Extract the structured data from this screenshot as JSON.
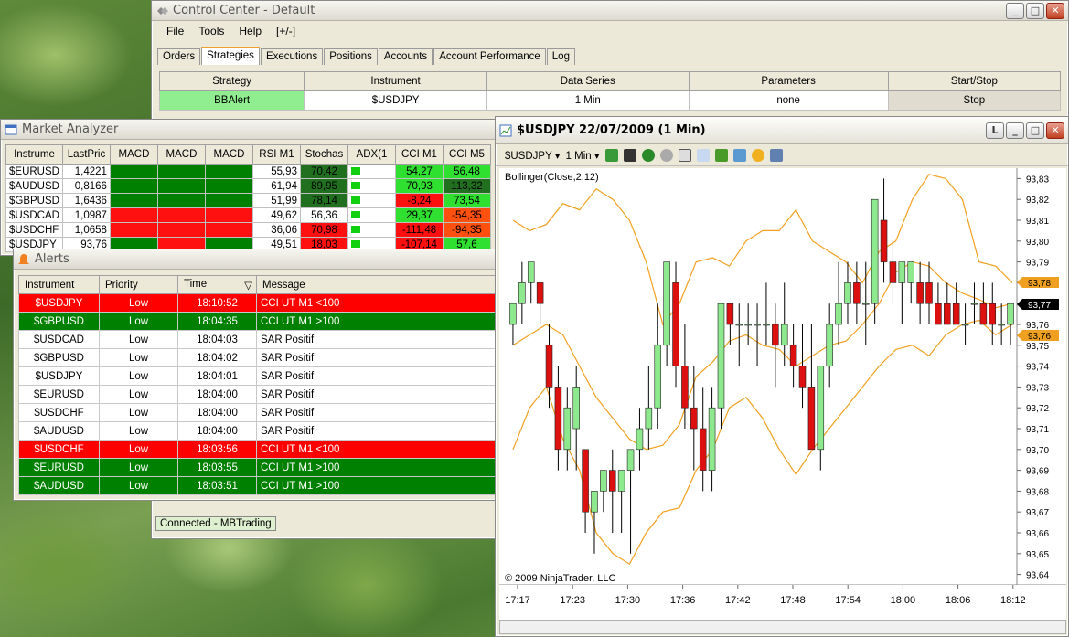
{
  "control_center": {
    "title": "Control Center - Default",
    "menu": [
      "File",
      "Tools",
      "Help",
      "[+/-]"
    ],
    "tabs": [
      "Orders",
      "Strategies",
      "Executions",
      "Positions",
      "Accounts",
      "Account Performance",
      "Log"
    ],
    "selected_tab": "Strategies",
    "strategy_table": {
      "headers": [
        "Strategy",
        "Instrument",
        "Data Series",
        "Parameters",
        "Start/Stop"
      ],
      "rows": [
        {
          "strategy": "BBAlert",
          "instrument": "$USDJPY",
          "series": "1 Min",
          "params": "none",
          "action": "Stop"
        }
      ]
    },
    "status": "Connected - MBTrading"
  },
  "market_analyzer": {
    "title": "Market Analyzer",
    "headers": [
      "Instrume",
      "LastPric",
      "MACD",
      "MACD",
      "MACD",
      "RSI M1",
      "Stochas",
      "ADX(1",
      "CCI M1",
      "CCI M5"
    ],
    "rows": [
      {
        "inst": "$EURUSD",
        "last": "1,4221",
        "macd": [
          "g",
          "g",
          "g"
        ],
        "rsi": "55,93",
        "stoch": "70,42",
        "stoch_c": "dg",
        "adx": "g",
        "cci1": "54,27",
        "cci1_c": "lg",
        "cci5": "56,48",
        "cci5_c": "lg"
      },
      {
        "inst": "$AUDUSD",
        "last": "0,8166",
        "macd": [
          "g",
          "g",
          "g"
        ],
        "rsi": "61,94",
        "stoch": "89,95",
        "stoch_c": "dg",
        "adx": "g",
        "cci1": "70,93",
        "cci1_c": "lg",
        "cci5": "113,32",
        "cci5_c": "dg"
      },
      {
        "inst": "$GBPUSD",
        "last": "1,6436",
        "macd": [
          "g",
          "g",
          "g"
        ],
        "rsi": "51,99",
        "stoch": "78,14",
        "stoch_c": "dg",
        "adx": "g",
        "cci1": "-8,24",
        "cci1_c": "r",
        "cci5": "73,54",
        "cci5_c": "lg"
      },
      {
        "inst": "$USDCAD",
        "last": "1,0987",
        "macd": [
          "r",
          "r",
          "r"
        ],
        "rsi": "49,62",
        "stoch": "56,36",
        "stoch_c": "w",
        "adx": "g",
        "cci1": "29,37",
        "cci1_c": "lg",
        "cci5": "-54,35",
        "cci5_c": "o"
      },
      {
        "inst": "$USDCHF",
        "last": "1,0658",
        "macd": [
          "r",
          "r",
          "r"
        ],
        "rsi": "36,06",
        "stoch": "70,98",
        "stoch_c": "r",
        "adx": "g",
        "cci1": "-111,48",
        "cci1_c": "r",
        "cci5": "-94,35",
        "cci5_c": "o"
      },
      {
        "inst": "$USDJPY",
        "last": "93,76",
        "macd": [
          "g",
          "r",
          "g"
        ],
        "rsi": "49,51",
        "stoch": "18,03",
        "stoch_c": "r",
        "adx": "g",
        "cci1": "-107,14",
        "cci1_c": "r",
        "cci5": "57,6",
        "cci5_c": "lg"
      }
    ]
  },
  "alerts": {
    "title": "Alerts",
    "headers": [
      "Instrument",
      "Priority",
      "Time",
      "Message"
    ],
    "rows": [
      {
        "inst": "$USDJPY",
        "pri": "Low",
        "time": "18:10:52",
        "msg": "CCI UT M1 <100",
        "bg": "red"
      },
      {
        "inst": "$GBPUSD",
        "pri": "Low",
        "time": "18:04:35",
        "msg": "CCI UT M1 >100",
        "bg": "green"
      },
      {
        "inst": "$USDCAD",
        "pri": "Low",
        "time": "18:04:03",
        "msg": "SAR Positif",
        "bg": "white"
      },
      {
        "inst": "$GBPUSD",
        "pri": "Low",
        "time": "18:04:02",
        "msg": "SAR Positif",
        "bg": "white"
      },
      {
        "inst": "$USDJPY",
        "pri": "Low",
        "time": "18:04:01",
        "msg": "SAR Positif",
        "bg": "white"
      },
      {
        "inst": "$EURUSD",
        "pri": "Low",
        "time": "18:04:00",
        "msg": "SAR Positif",
        "bg": "white"
      },
      {
        "inst": "$USDCHF",
        "pri": "Low",
        "time": "18:04:00",
        "msg": "SAR Positif",
        "bg": "white"
      },
      {
        "inst": "$AUDUSD",
        "pri": "Low",
        "time": "18:04:00",
        "msg": "SAR Positif",
        "bg": "white"
      },
      {
        "inst": "$USDCHF",
        "pri": "Low",
        "time": "18:03:56",
        "msg": "CCI UT M1 <100",
        "bg": "red"
      },
      {
        "inst": "$EURUSD",
        "pri": "Low",
        "time": "18:03:55",
        "msg": "CCI UT M1 >100",
        "bg": "green"
      },
      {
        "inst": "$AUDUSD",
        "pri": "Low",
        "time": "18:03:51",
        "msg": "CCI UT M1 >100",
        "bg": "green"
      }
    ]
  },
  "chart_window": {
    "title": "$USDJPY  22/07/2009 (1 Min)",
    "instrument": "$USDJPY",
    "interval": "1 Min",
    "indicator": "Bollinger(Close,2,12)",
    "copyright": "© 2009 NinjaTrader, LLC",
    "price_badges": [
      "93,78",
      "93,77",
      "93,76"
    ]
  },
  "colors": {
    "up": "#8ee88e",
    "down": "#dd1010",
    "band": "#f0a020",
    "green": "#008000",
    "red": "#ff0000"
  },
  "chart_data": {
    "type": "candlestick",
    "title": "",
    "x": [
      "17:17",
      "17:23",
      "17:30",
      "17:36",
      "17:42",
      "17:48",
      "17:54",
      "18:00",
      "18:06",
      "18:12"
    ],
    "ylim": [
      93.635,
      93.835
    ],
    "yticks": [
      "93,64",
      "93,65",
      "93,66",
      "93,67",
      "93,68",
      "93,69",
      "93,70",
      "93,71",
      "93,72",
      "93,73",
      "93,74",
      "93,75",
      "93,76",
      "93,77",
      "93,78",
      "93,79",
      "93,80",
      "93,81",
      "93,82",
      "93,83"
    ],
    "candles": [
      [
        93.76,
        93.77,
        93.75,
        93.77
      ],
      [
        93.77,
        93.79,
        93.76,
        93.78
      ],
      [
        93.78,
        93.79,
        93.77,
        93.79
      ],
      [
        93.78,
        93.78,
        93.76,
        93.77
      ],
      [
        93.75,
        93.76,
        93.72,
        93.73
      ],
      [
        93.73,
        93.74,
        93.69,
        93.7
      ],
      [
        93.7,
        93.73,
        93.69,
        93.72
      ],
      [
        93.71,
        93.74,
        93.69,
        93.73
      ],
      [
        93.7,
        93.7,
        93.66,
        93.67
      ],
      [
        93.67,
        93.68,
        93.65,
        93.68
      ],
      [
        93.68,
        93.69,
        93.67,
        93.69
      ],
      [
        93.69,
        93.7,
        93.66,
        93.68
      ],
      [
        93.68,
        93.69,
        93.66,
        93.69
      ],
      [
        93.69,
        93.7,
        93.65,
        93.7
      ],
      [
        93.7,
        93.72,
        93.69,
        93.71
      ],
      [
        93.71,
        93.74,
        93.7,
        93.72
      ],
      [
        93.72,
        93.77,
        93.71,
        93.75
      ],
      [
        93.75,
        93.79,
        93.74,
        93.79
      ],
      [
        93.78,
        93.79,
        93.73,
        93.74
      ],
      [
        93.74,
        93.76,
        93.71,
        93.72
      ],
      [
        93.72,
        93.74,
        93.69,
        93.71
      ],
      [
        93.71,
        93.73,
        93.68,
        93.69
      ],
      [
        93.69,
        93.73,
        93.68,
        93.72
      ],
      [
        93.72,
        93.77,
        93.71,
        93.77
      ],
      [
        93.77,
        93.77,
        93.75,
        93.76
      ],
      [
        93.76,
        93.77,
        93.74,
        93.76
      ],
      [
        93.76,
        93.77,
        93.75,
        93.76
      ],
      [
        93.76,
        93.77,
        93.74,
        93.76
      ],
      [
        93.76,
        93.78,
        93.75,
        93.76
      ],
      [
        93.76,
        93.77,
        93.73,
        93.75
      ],
      [
        93.75,
        93.78,
        93.74,
        93.76
      ],
      [
        93.75,
        93.76,
        93.73,
        93.74
      ],
      [
        93.74,
        93.76,
        93.72,
        93.73
      ],
      [
        93.73,
        93.76,
        93.7,
        93.7
      ],
      [
        93.7,
        93.74,
        93.69,
        93.74
      ],
      [
        93.74,
        93.77,
        93.73,
        93.76
      ],
      [
        93.76,
        93.79,
        93.75,
        93.77
      ],
      [
        93.77,
        93.79,
        93.76,
        93.78
      ],
      [
        93.78,
        93.79,
        93.76,
        93.77
      ],
      [
        93.77,
        93.79,
        93.75,
        93.77
      ],
      [
        93.77,
        93.82,
        93.76,
        93.82
      ],
      [
        93.81,
        93.83,
        93.78,
        93.79
      ],
      [
        93.79,
        93.8,
        93.77,
        93.78
      ],
      [
        93.78,
        93.79,
        93.76,
        93.79
      ],
      [
        93.78,
        93.79,
        93.77,
        93.79
      ],
      [
        93.78,
        93.79,
        93.76,
        93.77
      ],
      [
        93.78,
        93.79,
        93.76,
        93.77
      ],
      [
        93.77,
        93.78,
        93.76,
        93.76
      ],
      [
        93.77,
        93.78,
        93.76,
        93.76
      ],
      [
        93.77,
        93.78,
        93.76,
        93.76
      ],
      [
        93.76,
        93.77,
        93.75,
        93.76
      ],
      [
        93.77,
        93.78,
        93.76,
        93.77
      ],
      [
        93.77,
        93.78,
        93.76,
        93.76
      ],
      [
        93.77,
        93.78,
        93.75,
        93.76
      ],
      [
        93.76,
        93.77,
        93.75,
        93.76
      ],
      [
        93.76,
        93.77,
        93.75,
        93.77
      ]
    ],
    "upper_band": [
      93.81,
      93.805,
      93.808,
      93.818,
      93.815,
      93.825,
      93.82,
      93.81,
      93.79,
      93.76,
      93.77,
      93.79,
      93.792,
      93.788,
      93.8,
      93.805,
      93.805,
      93.815,
      93.8,
      93.795,
      93.79,
      93.78,
      93.795,
      93.8,
      93.82,
      93.832,
      93.83,
      93.82,
      93.79,
      93.788,
      93.78
    ],
    "middle_band": [
      93.75,
      93.755,
      93.76,
      93.755,
      93.74,
      93.725,
      93.715,
      93.705,
      93.7,
      93.702,
      93.712,
      93.735,
      93.742,
      93.752,
      93.755,
      93.75,
      93.748,
      93.74,
      93.745,
      93.75,
      93.752,
      93.76,
      93.77,
      93.785,
      93.79,
      93.788,
      93.78,
      93.775,
      93.772,
      93.768,
      93.77
    ],
    "lower_band": [
      93.7,
      93.72,
      93.73,
      93.705,
      93.69,
      93.66,
      93.65,
      93.645,
      93.66,
      93.67,
      93.672,
      93.69,
      93.7,
      93.72,
      93.725,
      93.715,
      93.7,
      93.688,
      93.7,
      93.71,
      93.72,
      93.73,
      93.74,
      93.748,
      93.75,
      93.745,
      93.755,
      93.76,
      93.762,
      93.755,
      93.76
    ]
  }
}
